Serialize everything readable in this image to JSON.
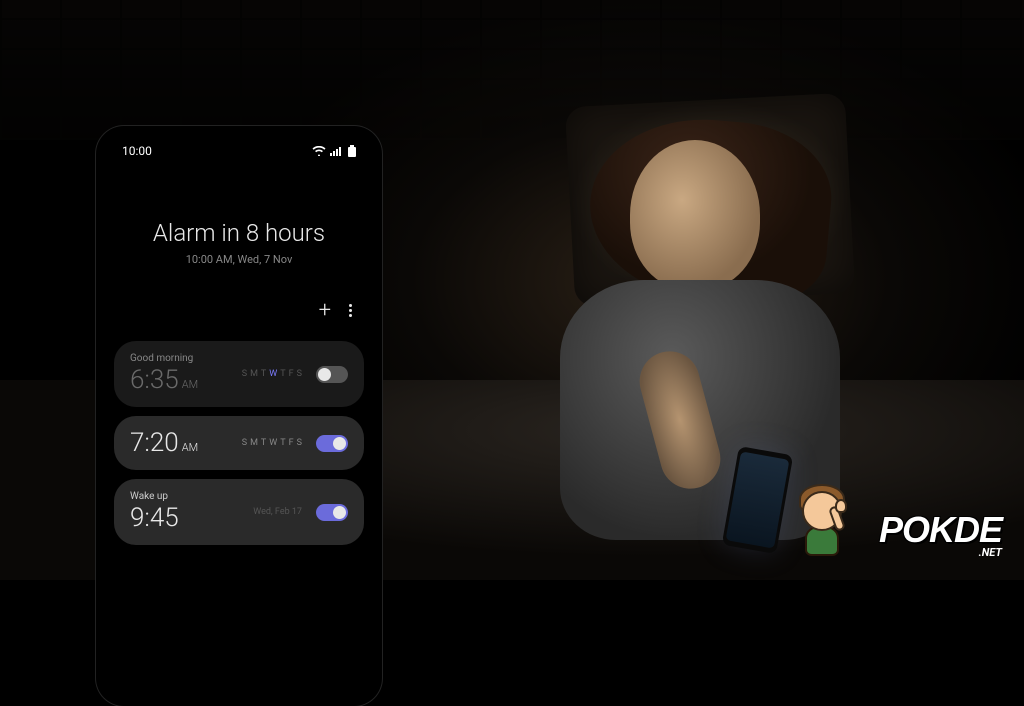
{
  "status_bar": {
    "time": "10:00"
  },
  "header": {
    "title": "Alarm in 8 hours",
    "subtitle": "10:00 AM, Wed, 7 Nov"
  },
  "days": [
    "S",
    "M",
    "T",
    "W",
    "T",
    "F",
    "S"
  ],
  "alarms": [
    {
      "label": "Good morning",
      "time": "6:35",
      "ampm": "AM",
      "enabled": false,
      "selected_days": [
        3
      ]
    },
    {
      "label": "",
      "time": "7:20",
      "ampm": "AM",
      "enabled": true,
      "selected_days": [
        3
      ]
    },
    {
      "label": "Wake up",
      "date": "Wed, Feb 17",
      "time": "9:45",
      "ampm": "",
      "enabled": true,
      "selected_days": []
    }
  ],
  "logo": {
    "brand": "POKDE",
    "suffix": ".NET"
  }
}
